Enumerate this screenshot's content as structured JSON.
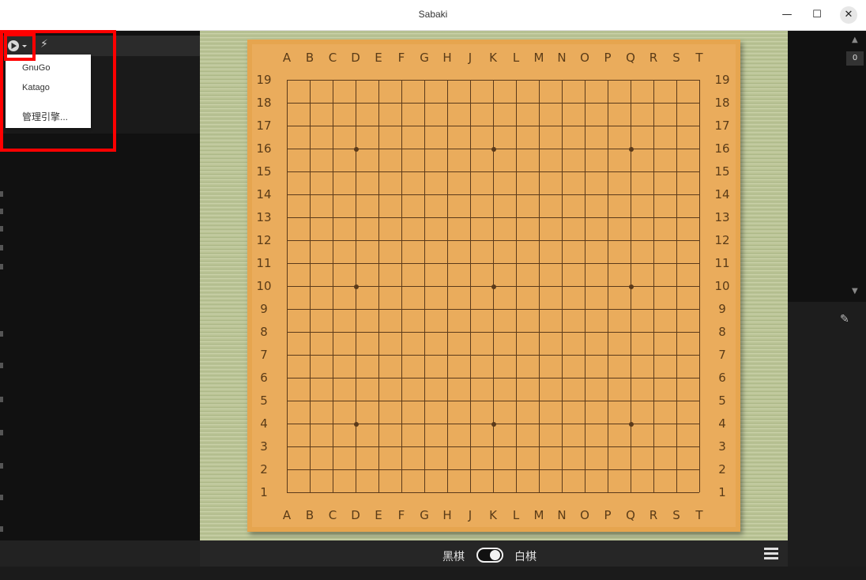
{
  "window": {
    "title": "Sabaki"
  },
  "engine_menu": {
    "items": [
      "GnuGo",
      "Katago",
      "管理引擎..."
    ]
  },
  "board": {
    "columns": [
      "A",
      "B",
      "C",
      "D",
      "E",
      "F",
      "G",
      "H",
      "J",
      "K",
      "L",
      "M",
      "N",
      "O",
      "P",
      "Q",
      "R",
      "S",
      "T"
    ],
    "rows": [
      "19",
      "18",
      "17",
      "16",
      "15",
      "14",
      "13",
      "12",
      "11",
      "10",
      "9",
      "8",
      "7",
      "6",
      "5",
      "4",
      "3",
      "2",
      "1"
    ],
    "star_points": [
      [
        "D",
        "16"
      ],
      [
        "K",
        "16"
      ],
      [
        "Q",
        "16"
      ],
      [
        "D",
        "10"
      ],
      [
        "K",
        "10"
      ],
      [
        "Q",
        "10"
      ],
      [
        "D",
        "4"
      ],
      [
        "K",
        "4"
      ],
      [
        "Q",
        "4"
      ]
    ]
  },
  "players": {
    "black": "黑棋",
    "white": "白棋"
  },
  "game_graph": {
    "move_counter": "0"
  },
  "colors": {
    "board": "#eaac5c",
    "grid": "#5b3a1a",
    "tatami": "#b3bd8f",
    "highlight": "#ff0000"
  }
}
